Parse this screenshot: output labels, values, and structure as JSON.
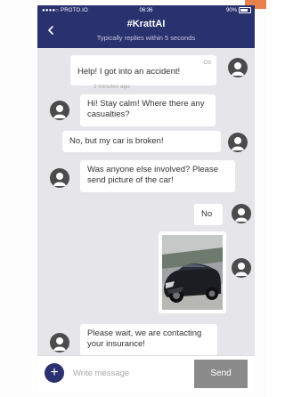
{
  "status_bar": {
    "carrier": "●●●●○ PROTO.IO",
    "time": "06:36",
    "battery": "90%"
  },
  "header": {
    "title": "#KrattAI",
    "subtitle": "Typically replies within 5 seconds",
    "back_icon": "chevron-left-icon"
  },
  "messages": [
    {
      "sender": "user",
      "text": "Help! I got into an accident!",
      "meta_right": "Ott",
      "meta_time": "2 minutes ago"
    },
    {
      "sender": "bot",
      "text": "Hi! Stay calm! Where there any casualties?"
    },
    {
      "sender": "user",
      "text": "No, but my car is broken!"
    },
    {
      "sender": "bot",
      "text": "Was anyone else involved? Please send picture of the car!"
    },
    {
      "sender": "user",
      "text": "No"
    },
    {
      "sender": "user",
      "type": "image",
      "image_desc": "damaged black car photo"
    },
    {
      "sender": "bot",
      "text": "Please wait, we are contacting your insurance!"
    }
  ],
  "composer": {
    "placeholder": "Write message",
    "send_label": "Send",
    "add_label": "+"
  },
  "colors": {
    "header_bg": "#29316e",
    "chat_bg": "#e6e6ea",
    "send_bg": "#8a8a8a",
    "accent": "#e9814c"
  }
}
